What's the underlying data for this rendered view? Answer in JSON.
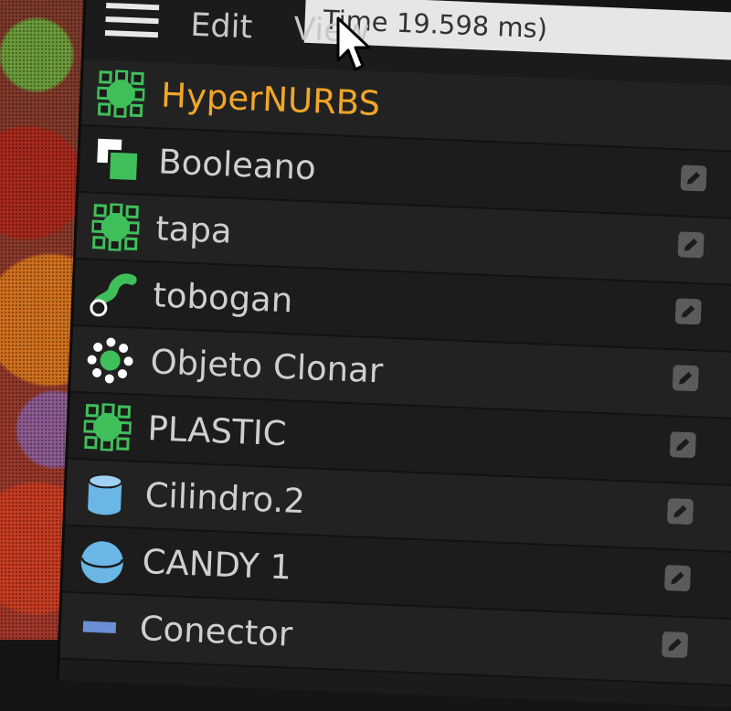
{
  "menubar": {
    "items": [
      "Edit",
      "View"
    ]
  },
  "timebar": {
    "text": "Time 19.598 ms)"
  },
  "objects": [
    {
      "label": "HyperNURBS",
      "icon": "hypernurbs-icon",
      "active": true
    },
    {
      "label": "Booleano",
      "icon": "boolean-icon"
    },
    {
      "label": "tapa",
      "icon": "hypernurbs-icon"
    },
    {
      "label": "tobogan",
      "icon": "sweep-icon"
    },
    {
      "label": "Objeto Clonar",
      "icon": "cloner-icon"
    },
    {
      "label": "PLASTIC",
      "icon": "hypernurbs-icon"
    },
    {
      "label": "Cilindro.2",
      "icon": "cylinder-icon"
    },
    {
      "label": "CANDY 1",
      "icon": "sphere-icon"
    },
    {
      "label": "Conector",
      "icon": "connector-icon"
    }
  ],
  "colors": {
    "active_label": "#f0a62a",
    "generator_green": "#3fbf5a",
    "primitive_blue": "#6ab6e6"
  }
}
